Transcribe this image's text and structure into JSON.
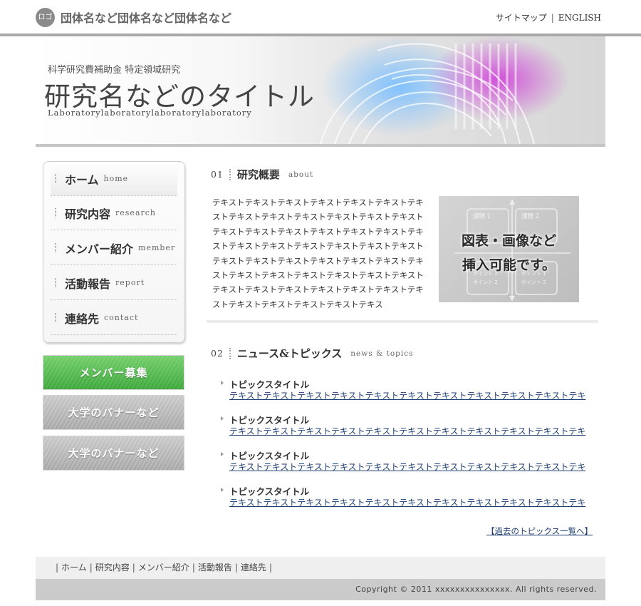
{
  "header": {
    "logo_text": "ロゴ",
    "org_name": "団体名など団体名など団体名など",
    "sitemap": "サイトマップ",
    "separator": "|",
    "english": "ENGLISH"
  },
  "banner": {
    "subtitle": "科学研究費補助金 特定領域研究",
    "title": "研究名などのタイトル",
    "lab": "Laboratorylaboratorylaboratorylaboratory"
  },
  "nav": [
    {
      "jp": "ホーム",
      "en": "home"
    },
    {
      "jp": "研究内容",
      "en": "research"
    },
    {
      "jp": "メンバー紹介",
      "en": "member"
    },
    {
      "jp": "活動報告",
      "en": "report"
    },
    {
      "jp": "連絡先",
      "en": "contact"
    }
  ],
  "side_banners": {
    "member": "メンバー募集",
    "uni1": "大学のバナーなど",
    "uni2": "大学のバナーなど"
  },
  "about": {
    "num": "01",
    "title": "研究概要",
    "en": "about",
    "text": "テキストテキストテキストテキストテキストテキストテキストテキストテキストテキストテキストテキストテキストテキストテキストテキストテキストテキストテキストテキストテキストテキストテキストテキストテキストテキストテキストテキストテキストテキストテキストテキストテキストテキストテキストテキストテキストテキストテキストテキストテキストテキストテキストテキストテキストテキストテキストテキストテキストテキストテキス",
    "figure_line1": "図表・画像など",
    "figure_line2": "挿入可能です。",
    "figure_label1": "課題 1",
    "figure_label2": "課題 2",
    "figure_point1": "ポイント 1",
    "figure_point2": "ポイント 2"
  },
  "news": {
    "num": "02",
    "title": "ニュース&トピックス",
    "en": "news & topics",
    "items": [
      {
        "title": "トピックスタイトル",
        "link": "テキストテキストテキストテキストテキストテキストテキストテキストテキストテキストテキ"
      },
      {
        "title": "トピックスタイトル",
        "link": "テキストテキストテキストテキストテキストテキストテキストテキストテキストテキストテキ"
      },
      {
        "title": "トピックスタイトル",
        "link": "テキストテキストテキストテキストテキストテキストテキストテキストテキストテキストテキ"
      },
      {
        "title": "トピックスタイトル",
        "link": "テキストテキストテキストテキストテキストテキストテキストテキストテキストテキストテキ"
      }
    ],
    "past_link": "【過去のトピックス一覧へ】"
  },
  "footer": {
    "sep": "|",
    "links": [
      "ホーム",
      "研究内容",
      "メンバー紹介",
      "活動報告",
      "連絡先"
    ],
    "copyright": "Copyright © 2011 xxxxxxxxxxxxxxx. All rights reserved."
  }
}
